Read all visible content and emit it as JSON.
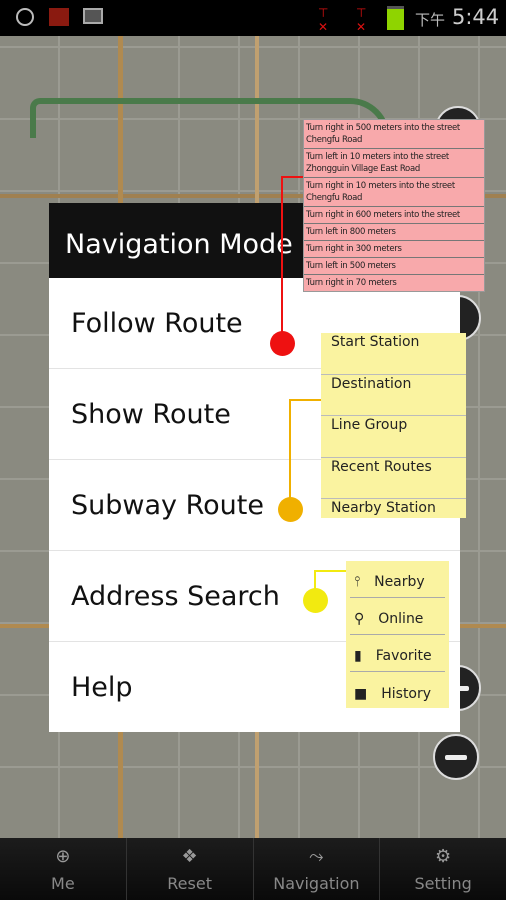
{
  "status_bar": {
    "time": "5:44",
    "ampm": "下午",
    "icons": [
      "gps-icon",
      "flag-icon",
      "gmail-icon",
      "no-signal-icon",
      "no-signal-icon",
      "battery-icon"
    ],
    "battery_color": "#8fd400"
  },
  "dialog": {
    "title": "Navigation Mode",
    "items": [
      "Follow Route",
      "Show Route",
      "Subway Route",
      "Address Search",
      "Help"
    ]
  },
  "route_steps": [
    "Turn right in 500 meters into the street Chengfu Road",
    "Turn left in 10 meters into the street Zhongguin Village East Road",
    "Turn right in 10 meters into the street Chengfu Road",
    "Turn right in 600 meters into the street",
    "Turn left in 800 meters",
    "Turn right in 300 meters",
    "Turn left in 500 meters",
    "Turn right in 70 meters"
  ],
  "subway_options": [
    "Start Station",
    "Destination",
    "Line Group",
    "Recent Routes",
    "Nearby Station"
  ],
  "address_options": [
    {
      "label": "Nearby",
      "icon": "pin-icon"
    },
    {
      "label": "Online",
      "icon": "search-icon"
    },
    {
      "label": "Favorite",
      "icon": "bookmark-icon"
    },
    {
      "label": "History",
      "icon": "book-icon"
    }
  ],
  "bottom_bar": [
    {
      "label": "Me",
      "icon": "locate-icon"
    },
    {
      "label": "Reset",
      "icon": "dropbox-icon"
    },
    {
      "label": "Navigation",
      "icon": "route-icon"
    },
    {
      "label": "Setting",
      "icon": "gear-icon"
    }
  ],
  "colors": {
    "follow_dot": "#ee1111",
    "subway_dot": "#f0b000",
    "address_dot": "#f2ea10",
    "pink_panel": "#f8a9ab",
    "yellow_panel": "#faf3a0"
  }
}
